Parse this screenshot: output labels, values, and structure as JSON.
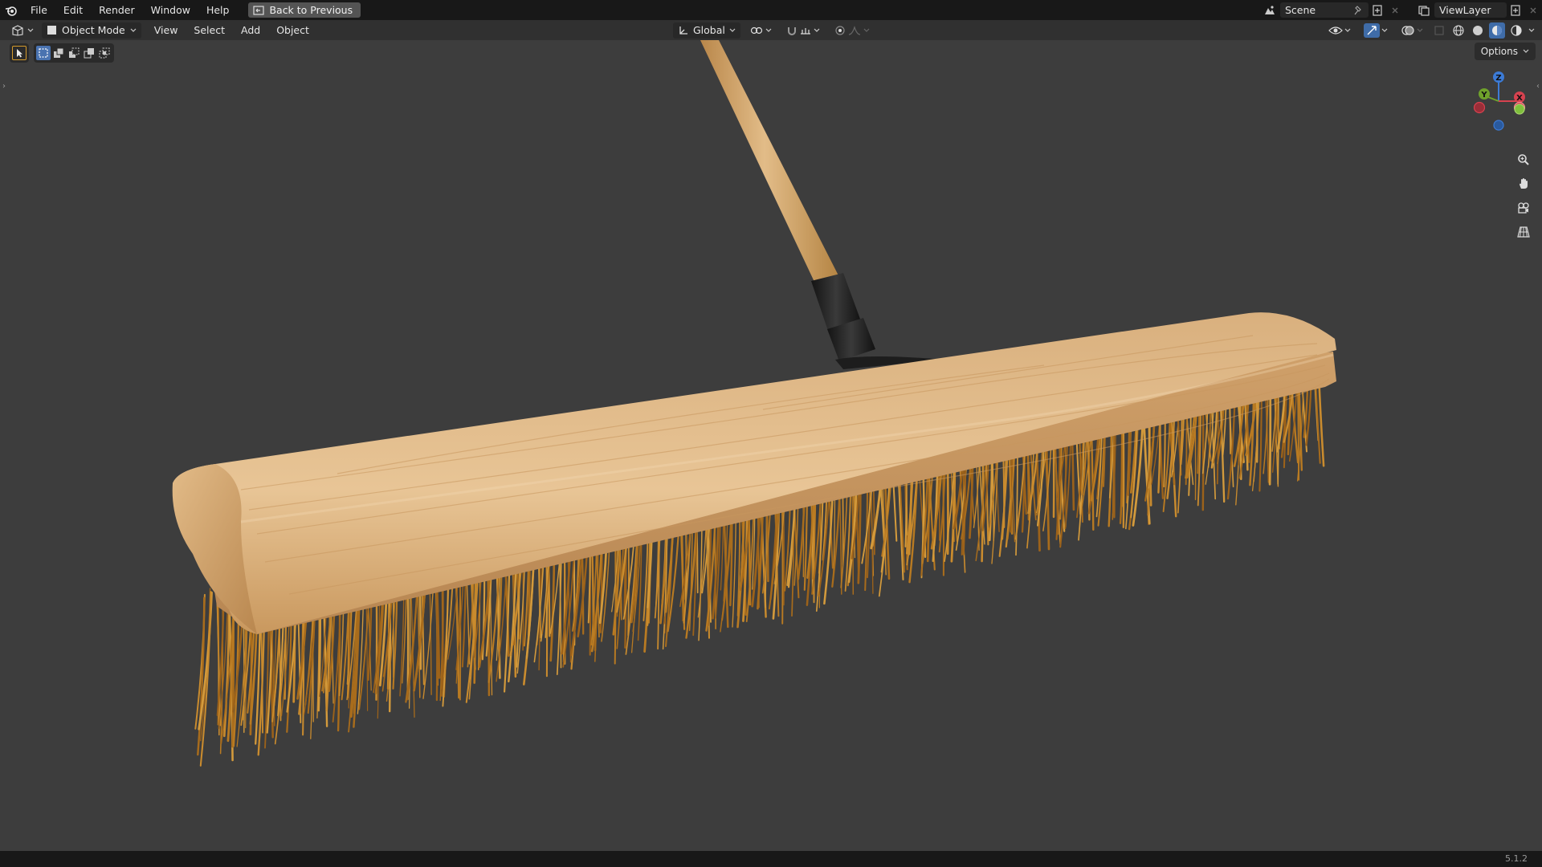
{
  "topbar": {
    "menus": [
      "File",
      "Edit",
      "Render",
      "Window",
      "Help"
    ],
    "back_button": "Back to Previous",
    "scene_name": "Scene",
    "view_layer": "ViewLayer"
  },
  "header": {
    "mode": "Object Mode",
    "menus": [
      "View",
      "Select",
      "Add",
      "Object"
    ],
    "orientation": "Global"
  },
  "viewport": {
    "options_label": "Options",
    "gizmo": {
      "x": "X",
      "y": "Y",
      "z": "Z"
    }
  },
  "statusbar": {
    "version": "5.1.2"
  },
  "colors": {
    "viewport_bg": "#3d3d3d",
    "header_bg": "#303030",
    "topbar_bg": "#181818",
    "axis_x": "#d7424f",
    "axis_y": "#6fa22b",
    "axis_z": "#3c7bd6",
    "wood": "#d9b07c",
    "bristle": "#b87a22"
  }
}
